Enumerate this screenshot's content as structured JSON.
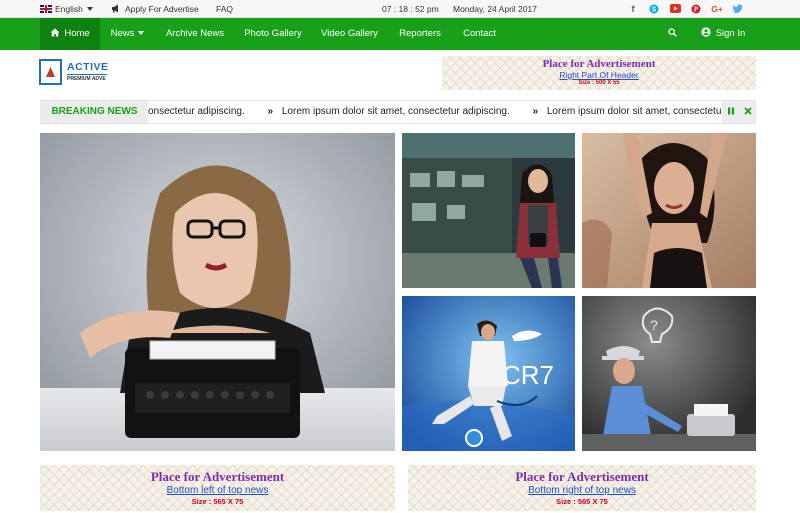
{
  "topbar": {
    "language": "English",
    "advertise": "Apply For Advertise",
    "faq": "FAQ",
    "time": "07 : 18 : 52  pm",
    "date": "Monday, 24 April 2017",
    "social_icons": [
      "facebook-icon",
      "skype-icon",
      "youtube-icon",
      "pinterest-icon",
      "google-plus-icon",
      "twitter-icon"
    ]
  },
  "nav": {
    "items": [
      "Home",
      "News",
      "Archive News",
      "Photo Gallery",
      "Video Gallery",
      "Reporters",
      "Contact"
    ],
    "sign_in": "Sign In"
  },
  "logo": {
    "name": "ACTIVE",
    "tagline": "PREMIUM ADVE"
  },
  "header_ad": {
    "title": "Place for Advertisement",
    "subtitle": "Right Part Of Header",
    "size": "Size : 500 X 55"
  },
  "breaking": {
    "label": "BREAKING NEWS",
    "items": [
      "onsectetur adipiscing.",
      "Lorem ipsum dolor sit amet, consectetur adipiscing.",
      "Lorem ipsum dolor sit amet, consectetur adipiscing."
    ]
  },
  "bottom_ads": [
    {
      "title": "Place for Advertisement",
      "subtitle": "Bottom left of top news",
      "size": "Size : 565 X 75"
    },
    {
      "title": "Place for Advertisement",
      "subtitle": "Bottom right of top news",
      "size": "Size : 565 X 75"
    }
  ],
  "photo_text": {
    "cr7": "CR7"
  },
  "colors": {
    "primary_green": "#19a019",
    "active_green": "#0e820e",
    "ad_title": "#7b2cb3",
    "ad_link": "#1f4fd0",
    "ad_size": "#d0021b"
  }
}
